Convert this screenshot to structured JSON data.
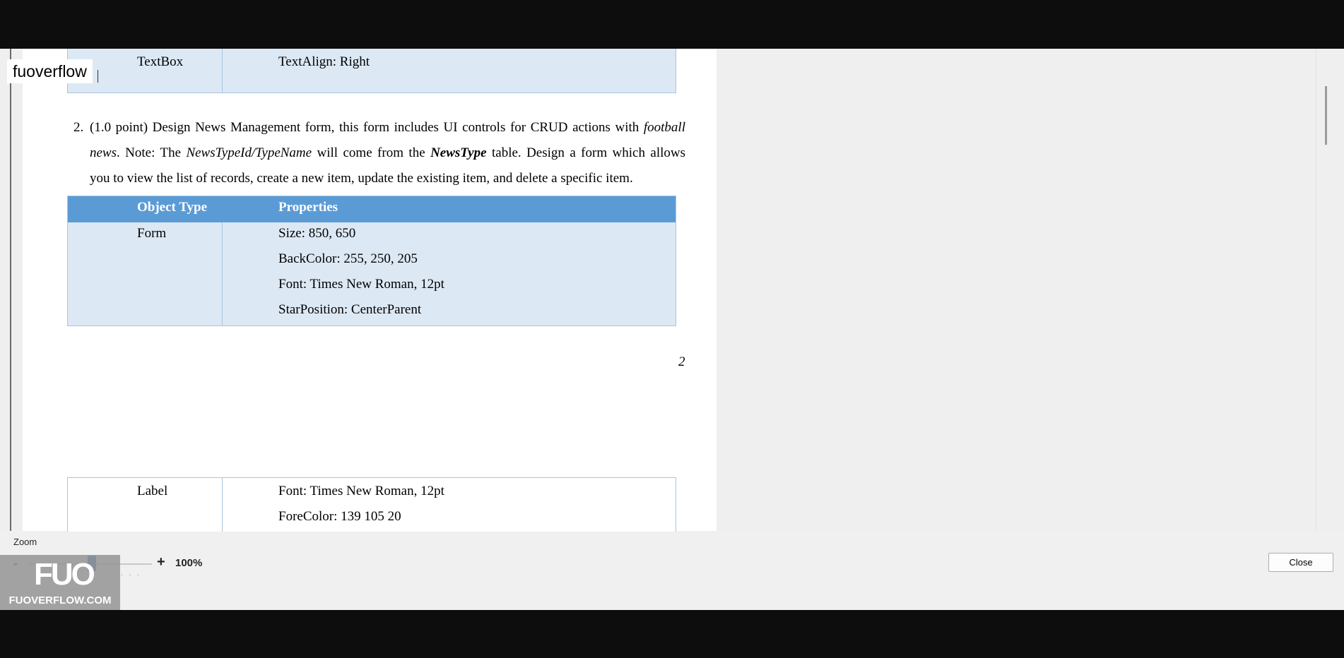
{
  "watermark_text": "fuoverflow",
  "document": {
    "top_table": {
      "col1": "TextBox",
      "col2": "TextAlign: Right"
    },
    "question": {
      "number": "2.",
      "line1_parts": [
        "(1.0 point) Design News Management form, this form includes UI controls for CRUD actions with ",
        "football"
      ],
      "line2_parts": [
        "news",
        ". Note: The ",
        "NewsTypeId/TypeName",
        " will come from the ",
        "NewsType",
        " table. Design a form which allows"
      ],
      "line3": "you to view the list of records, create a new item, update the existing item, and delete a specific item."
    },
    "form_table": {
      "header": {
        "col1": "Object Type",
        "col2": "Properties"
      },
      "object_type": "Form",
      "properties": [
        "Size: 850, 650",
        "BackColor: 255, 250, 205",
        "Font: Times New Roman, 12pt",
        "StarPosition: CenterParent"
      ]
    },
    "page_number": "2",
    "label_table": {
      "object_type": "Label",
      "properties": [
        "Font: Times New Roman, 12pt",
        "ForeColor: 139 105 20"
      ]
    }
  },
  "zoom": {
    "label": "Zoom",
    "minus": "-",
    "plus": "+",
    "value": "100%",
    "level_percent": 100
  },
  "logo": {
    "mark": "FUO",
    "caption": "FUOVERFLOW.COM"
  },
  "close_button": "Close",
  "colors": {
    "header_blue": "#5b9bd5",
    "row_light_blue": "#dce8f4",
    "zoom_thumb": "#1e5fa8"
  }
}
